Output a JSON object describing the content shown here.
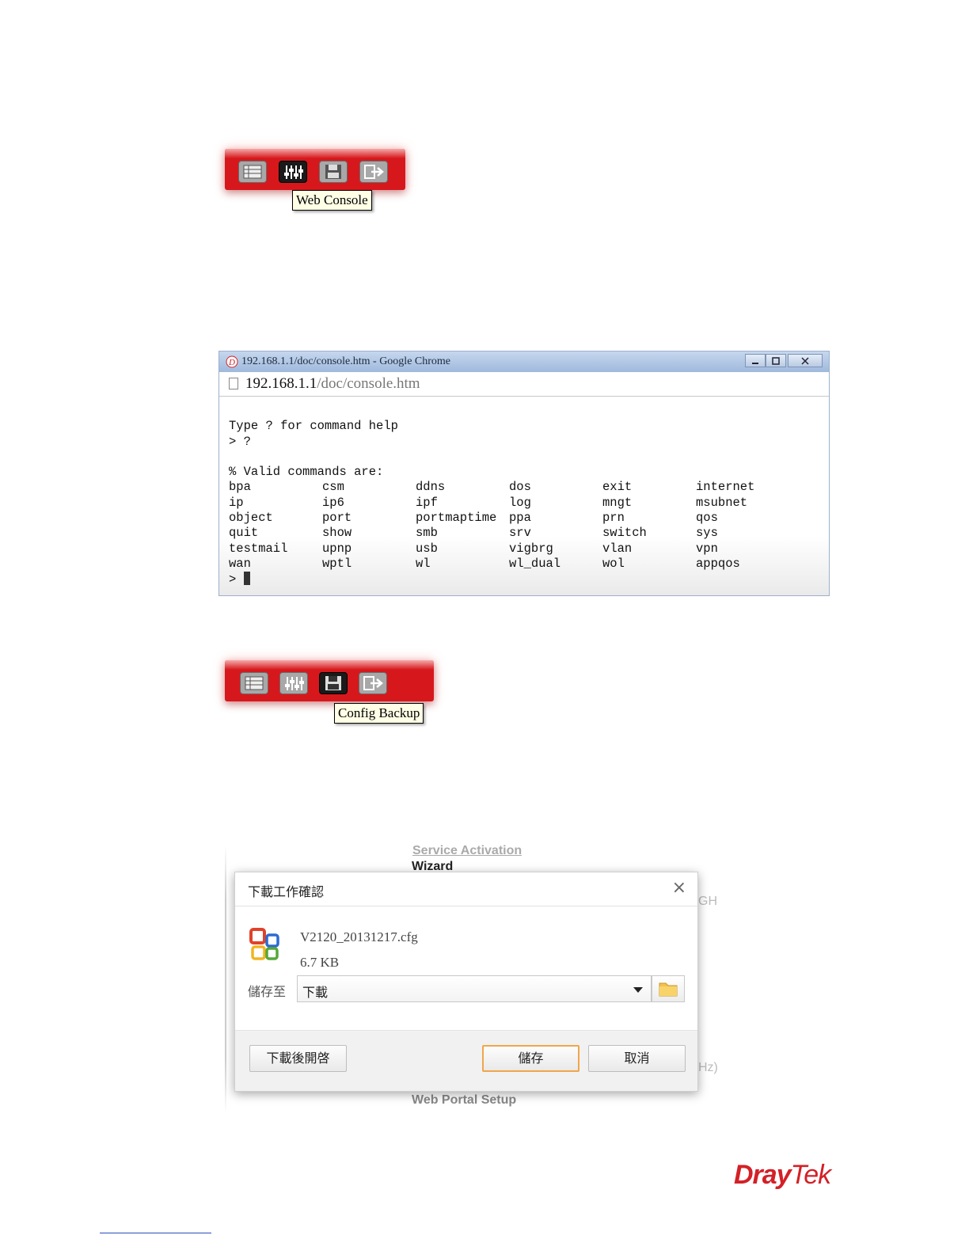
{
  "toolbar1": {
    "buttons": [
      {
        "icon": "list-icon"
      },
      {
        "icon": "sliders-icon"
      },
      {
        "icon": "floppy-disk-icon"
      },
      {
        "icon": "logout-icon"
      }
    ],
    "tooltip": "Web Console"
  },
  "browser": {
    "title": "192.168.1.1/doc/console.htm - Google Chrome",
    "url_host": "192.168.1.1",
    "url_path": "/doc/console.htm",
    "console": {
      "line1": "Type ? for command help",
      "line2": "> ?",
      "line3": "% Valid commands are:",
      "commands": [
        [
          "bpa",
          "csm",
          "ddns",
          "dos",
          "exit",
          "internet"
        ],
        [
          "ip",
          "ip6",
          "ipf",
          "log",
          "mngt",
          "msubnet"
        ],
        [
          "object",
          "port",
          "portmaptime",
          "ppa",
          "prn",
          "qos"
        ],
        [
          "quit",
          "show",
          "smb",
          "srv",
          "switch",
          "sys"
        ],
        [
          "testmail",
          "upnp",
          "usb",
          "vigbrg",
          "vlan",
          "vpn"
        ],
        [
          "wan",
          "wptl",
          "wl",
          "wl_dual",
          "wol",
          "appqos"
        ]
      ],
      "prompt": "> "
    }
  },
  "toolbar2": {
    "tooltip": "Config Backup"
  },
  "background_page": {
    "item_service": "Service Activation",
    "item_wizard": "Wizard",
    "item_gh": "GH",
    "item_hz": "Hz)",
    "item_portal": "Web Portal Setup"
  },
  "dialog": {
    "title": "下載工作確認",
    "close": "×",
    "file_name": "V2120_20131217.cfg",
    "file_size": "6.7 KB",
    "save_to_label": "儲存至",
    "save_to_value": "下載",
    "open_after_button": "下載後開啓",
    "save_button": "儲存",
    "cancel_button": "取消"
  },
  "brand": {
    "logo_text_dray": "Dray",
    "logo_text_tek": "Tek",
    "color": "#d42027"
  }
}
